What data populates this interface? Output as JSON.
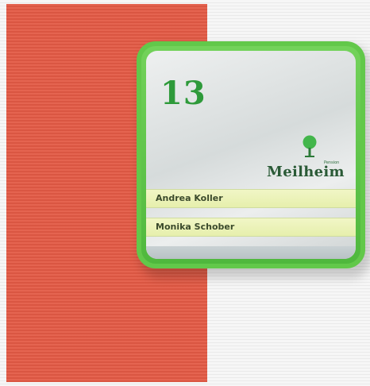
{
  "scene": {
    "wall_color": "#f4f4f4",
    "panel_color": "#e35a45",
    "frame_color": "#62c84a"
  },
  "sign": {
    "room_number": "13",
    "logo": {
      "small_text": "Pension",
      "name": "Meilheim",
      "icon": "tree-icon"
    },
    "names": [
      "Andrea Koller",
      "Monika Schober"
    ]
  }
}
